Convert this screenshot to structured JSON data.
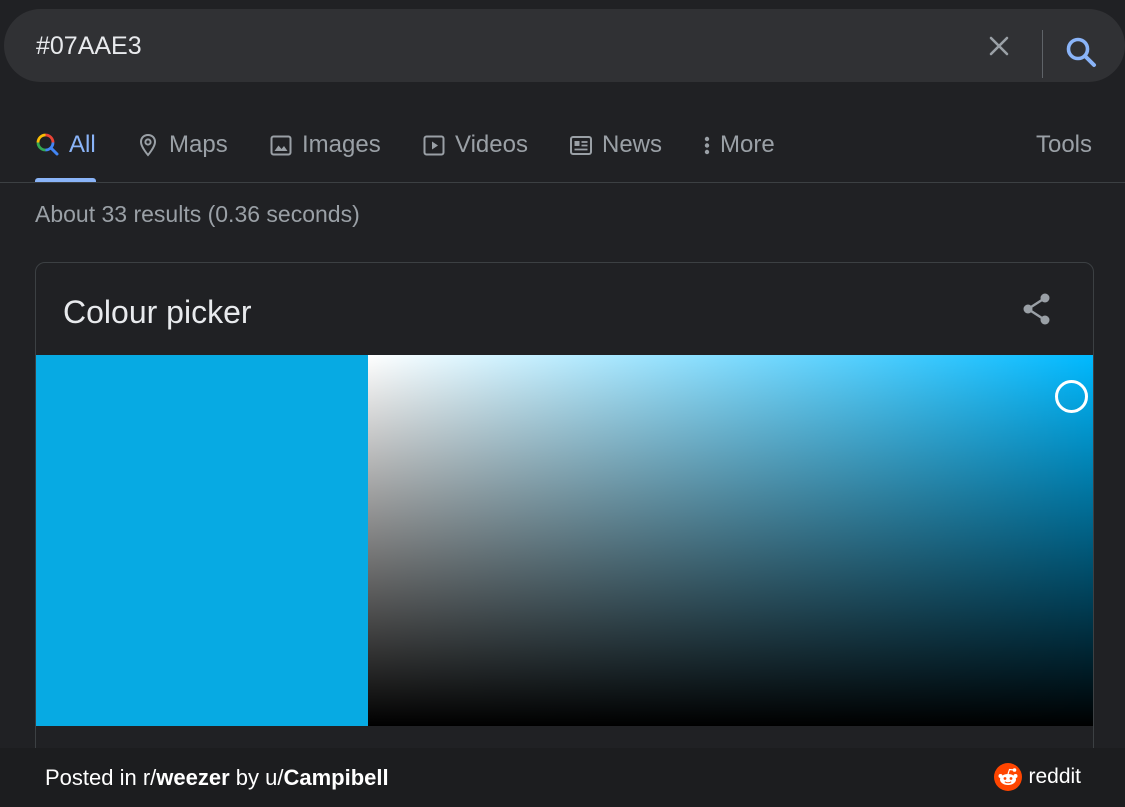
{
  "search": {
    "query": "#07AAE3"
  },
  "tabs": [
    {
      "label": "All",
      "icon": "google-multicolor-search-icon",
      "active": true
    },
    {
      "label": "Maps",
      "icon": "map-pin-icon"
    },
    {
      "label": "Images",
      "icon": "image-icon"
    },
    {
      "label": "Videos",
      "icon": "play-icon"
    },
    {
      "label": "News",
      "icon": "newspaper-icon"
    },
    {
      "label": "More",
      "icon": "more-vertical-icon"
    }
  ],
  "tools_label": "Tools",
  "result_stats": "About 33 results (0.36 seconds)",
  "picker": {
    "title": "Colour picker",
    "selected_color": "#07AAE3",
    "hue_color": "#00B9FF",
    "saturation": 0.97,
    "value": 0.89
  },
  "footer": {
    "posted_in": "Posted in r/",
    "subreddit": "weezer",
    "by": " by u/",
    "user": "Campibell",
    "brand": "reddit"
  },
  "colors": {
    "background": "#202124",
    "surface": "#303134",
    "accent": "#8ab4f8",
    "muted_text": "#9aa0a6",
    "reddit_orange": "#FF4500"
  }
}
